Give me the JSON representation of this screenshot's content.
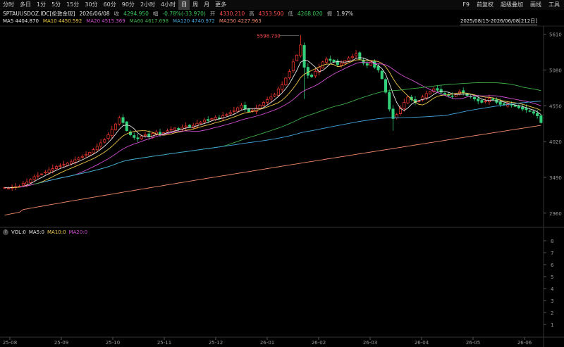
{
  "toolbar": {
    "timeframes": [
      "分时",
      "多日",
      "1分",
      "5分",
      "15分",
      "30分",
      "60分",
      "90分",
      "2小时",
      "4小时",
      "日",
      "周",
      "月",
      "更多"
    ],
    "active": "日",
    "right": [
      "F9",
      "前复权",
      "超级叠加",
      "画线",
      "工具"
    ]
  },
  "info": {
    "symbol": "SPTAUUSDOZ.IDC[伦敦金现]",
    "date": "2026/06/08",
    "close_label": "收",
    "close": "4294.950",
    "change_label": "幅",
    "change": "-0.78%(-33.970)",
    "open_label": "开",
    "open": "4330.210",
    "high_label": "高",
    "high": "4353.500",
    "low_label": "低",
    "low": "4268.020",
    "amp_label": "振",
    "amp": "1.97%"
  },
  "ma": {
    "ma5": "MA5 4404.870",
    "ma10": "MA10 4450.592",
    "ma20": "MA20 4515.369",
    "ma60": "MA60 4617.698",
    "ma120": "MA120 4740.972",
    "ma250": "MA250 4227.963"
  },
  "range_label": "2025/08/15-2026/06/08[212日]",
  "volume": {
    "label": "VOL:0",
    "ma5": "MA5:0",
    "ma10": "MA10:0",
    "ma20": "MA20:0",
    "y_ticks": [
      "8",
      "7",
      "6",
      "5",
      "4",
      "3",
      "2",
      "1"
    ]
  },
  "colors": {
    "up": "#ff3b30",
    "down": "#33d07a",
    "ma5": "#e6e6e6",
    "ma10": "#f2c94c",
    "ma20": "#d14fd1",
    "ma60": "#3fae49",
    "ma120": "#43a3d9",
    "ma250": "#f08a6c"
  },
  "chart_data": {
    "type": "candlestick",
    "ylim": [
      2760,
      5720
    ],
    "y_ticks": [
      5610,
      5080,
      4550,
      4020,
      3490,
      2960
    ],
    "x_ticks": [
      "25-08",
      "25-09",
      "25-10",
      "25-11",
      "25-12",
      "26-01",
      "26-02",
      "26-03",
      "26-04",
      "26-05",
      "26-06"
    ],
    "high_annotation": "5598.730",
    "close_series": [
      3340,
      3330,
      3345,
      3350,
      3360,
      3400,
      3420,
      3460,
      3500,
      3520,
      3540,
      3570,
      3600,
      3620,
      3650,
      3660,
      3680,
      3700,
      3720,
      3750,
      3780,
      3800,
      3830,
      3860,
      3900,
      3950,
      4000,
      4050,
      4120,
      4200,
      4280,
      4370,
      4300,
      4180,
      4120,
      4080,
      4060,
      4100,
      4120,
      4090,
      4140,
      4160,
      4130,
      4150,
      4180,
      4200,
      4220,
      4200,
      4230,
      4250,
      4240,
      4260,
      4290,
      4310,
      4340,
      4330,
      4360,
      4380,
      4370,
      4400,
      4420,
      4450,
      4480,
      4520,
      4560,
      4500,
      4460,
      4480,
      4520,
      4560,
      4600,
      4640,
      4680,
      4720,
      4800,
      4860,
      4960,
      5060,
      5200,
      5300,
      5450,
      5120,
      5000,
      4980,
      5060,
      5120,
      5200,
      5240,
      5220,
      5200,
      5160,
      5180,
      5220,
      5260,
      5280,
      5320,
      5240,
      5180,
      5150,
      5200,
      5120,
      5080,
      4950,
      4750,
      4500,
      4360,
      4420,
      4520,
      4600,
      4680,
      4640,
      4600,
      4620,
      4680,
      4730,
      4760,
      4800,
      4780,
      4750,
      4720,
      4700,
      4690,
      4720,
      4760,
      4740,
      4700,
      4680,
      4650,
      4620,
      4600,
      4620,
      4660,
      4640,
      4600,
      4570,
      4560,
      4580,
      4560,
      4540,
      4520,
      4500,
      4490,
      4470,
      4440,
      4400,
      4300
    ]
  }
}
